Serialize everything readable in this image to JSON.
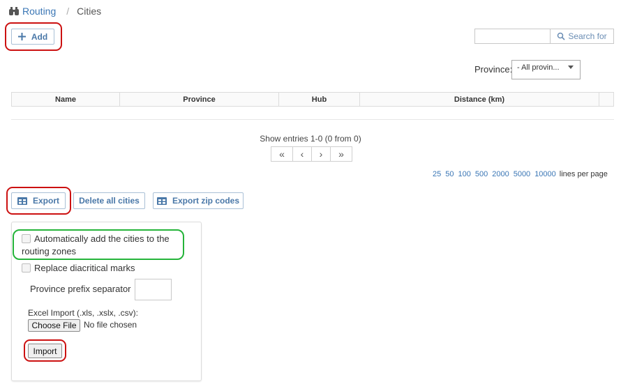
{
  "breadcrumb": {
    "icon": "binoculars-icon",
    "parent": "Routing",
    "separator": "/",
    "current": "Cities"
  },
  "toolbar": {
    "add_label": "Add",
    "search_placeholder": "",
    "search_label": "Search for",
    "province_label": "Province:",
    "province_value": "- All provin..."
  },
  "table": {
    "columns": [
      "Name",
      "Province",
      "Hub",
      "Distance (km)",
      ""
    ],
    "rows": []
  },
  "pagination": {
    "entries_text": "Show entries 1-0 (0 from 0)",
    "buttons": [
      "«",
      "‹",
      "›",
      "»"
    ],
    "page_sizes": [
      "25",
      "50",
      "100",
      "500",
      "2000",
      "5000",
      "10000"
    ],
    "lines_per_page_label": "lines per page"
  },
  "actions": {
    "export_label": "Export",
    "delete_all_label": "Delete all cities",
    "export_zip_label": "Export zip codes"
  },
  "import_panel": {
    "auto_add_line1": "Automatically add the cities to the",
    "auto_add_line2": "routing zones",
    "replace_diacritics": "Replace diacritical marks",
    "prefix_separator_label": "Province prefix separator",
    "prefix_separator_value": "",
    "excel_import_label": "Excel Import (.xls, .xslx, .csv):",
    "choose_file_label": "Choose File",
    "no_file_label": "No file chosen",
    "import_label": "Import"
  },
  "colors": {
    "link": "#3a76b5",
    "button_text": "#4a78a8",
    "highlight_red": "#cc1111",
    "highlight_green": "#25b43a"
  }
}
